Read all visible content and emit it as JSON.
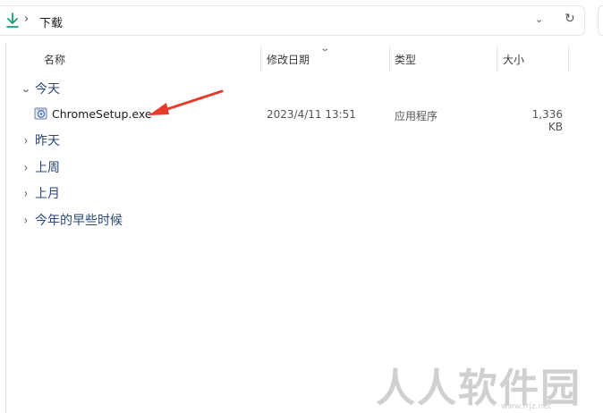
{
  "address_bar": {
    "breadcrumb": "下载"
  },
  "columns": {
    "name": "名称",
    "date": "修改日期",
    "type": "类型",
    "size": "大小"
  },
  "groups": {
    "today": "今天",
    "yesterday": "昨天",
    "last_week": "上周",
    "last_month": "上月",
    "earlier_this_year": "今年的早些时候"
  },
  "file": {
    "name": "ChromeSetup.exe",
    "modified": "2023/4/11 13:51",
    "type": "应用程序",
    "size": "1,336 KB"
  },
  "watermark": {
    "text": "人人软件园",
    "url": "www.rrjz.net"
  },
  "colors": {
    "download_icon": "#1a9e6f",
    "annotation_arrow": "#e8392a",
    "group_label": "#2b4a7a"
  }
}
